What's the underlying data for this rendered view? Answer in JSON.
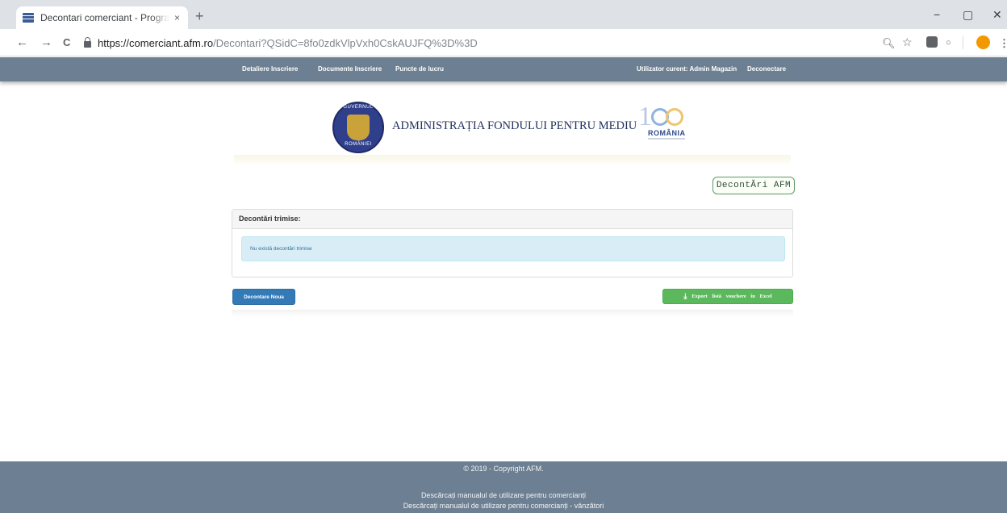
{
  "browser": {
    "tab_title": "Decontari comerciant - Programul",
    "tab_close": "×",
    "new_tab": "+",
    "url_host": "https://comerciant.afm.ro",
    "url_path": "/Decontari?QSidC=8fo0zdkVlpVxh0CskAUJFQ%3D%3D",
    "controls": {
      "minimize": "−",
      "maximize": "▢",
      "close": "✕"
    },
    "nav": {
      "back": "←",
      "forward": "→",
      "reload": "C"
    },
    "icons": [
      "zoom-icon",
      "star-icon",
      "extension-icon",
      "extension-icon",
      "profile-icon",
      "menu-icon"
    ]
  },
  "sitenav": {
    "detaliere": "Detaliere Inscriere",
    "documente": "Documente Inscriere",
    "puncte": "Puncte de lucru",
    "utilizator": "Utilizator curent: Admin Magazin",
    "deconectare": "Deconectare"
  },
  "header": {
    "org_name": "ADMINISTRAȚIA FONDULUI PENTRU MEDIU",
    "crest_top": "GUVERNUL",
    "crest_bottom": "ROMÂNIEI",
    "logo_number": "1",
    "logo_country": "ROMÂNIA",
    "badge": "DecontĂri AFM"
  },
  "panel": {
    "heading": "Decontări trimise:",
    "alert": "Nu există decontări trimise"
  },
  "actions": {
    "new": "Decontare Noua",
    "export": "Export listă vouchere în Excel"
  },
  "footer": {
    "copyright": "© 2019 - Copyright AFM.",
    "manual1": "Descărcați manualul de utilizare pentru comercianți",
    "manual2": "Descărcați manualul de utilizare pentru comercianți - vânzători"
  },
  "colors": {
    "navbar": "#6d7f92",
    "primary": "#337ab7",
    "success": "#5cb85c",
    "info_bg": "#d9edf7",
    "info_text": "#31708f"
  }
}
